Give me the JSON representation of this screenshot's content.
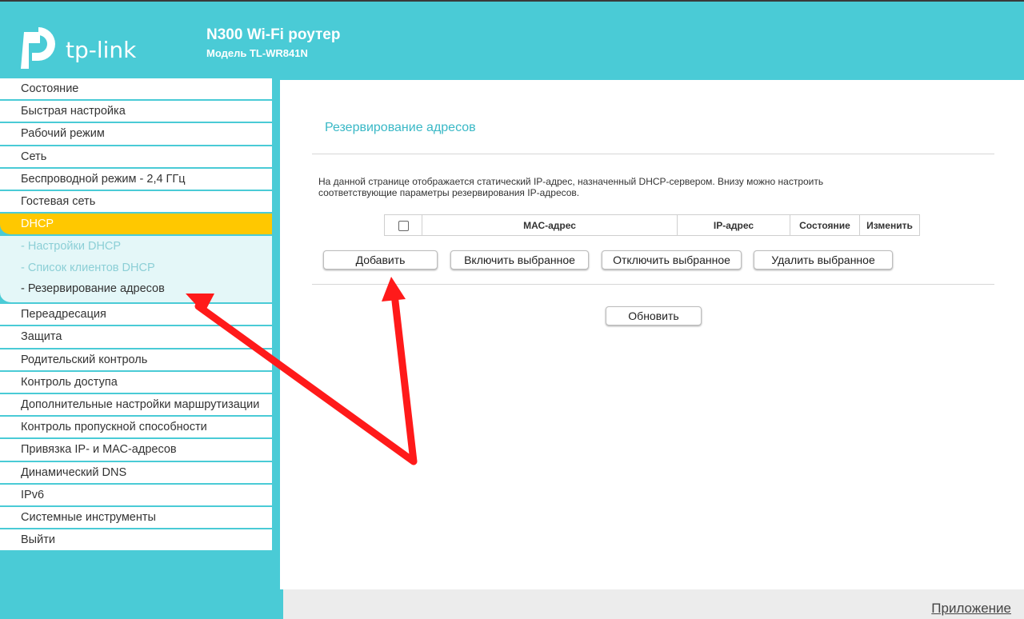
{
  "header": {
    "product_name": "N300 Wi-Fi роутер",
    "model_name": "Модель TL-WR841N",
    "logo_text": "tp-link"
  },
  "sidebar": {
    "items_top": [
      {
        "label": "Состояние"
      },
      {
        "label": "Быстрая настройка"
      },
      {
        "label": "Рабочий режим"
      },
      {
        "label": "Сеть"
      },
      {
        "label": "Беспроводной режим - 2,4 ГГц"
      },
      {
        "label": "Гостевая сеть"
      }
    ],
    "active_item": {
      "label": "DHCP"
    },
    "sub_items": [
      {
        "label": "- Настройки DHCP"
      },
      {
        "label": "- Список клиентов DHCP"
      },
      {
        "label": "- Резервирование адресов"
      }
    ],
    "items_bottom": [
      {
        "label": "Переадресация"
      },
      {
        "label": "Защита"
      },
      {
        "label": "Родительский контроль"
      },
      {
        "label": "Контроль доступа"
      },
      {
        "label": "Дополнительные настройки маршрутизации"
      },
      {
        "label": "Контроль пропускной способности"
      },
      {
        "label": "Привязка IP- и МАС-адресов"
      },
      {
        "label": "Динамический DNS"
      },
      {
        "label": "IPv6"
      },
      {
        "label": "Системные инструменты"
      },
      {
        "label": "Выйти"
      }
    ]
  },
  "main": {
    "title": "Резервирование адресов",
    "description_line1": "На данной странице отображается статический IP-адрес, назначенный DHCP-сервером. Внизу можно настроить",
    "description_line2": "соответствующие параметры резервирования IP-адресов.",
    "table": {
      "columns": [
        "МАС-адрес",
        "IP-адрес",
        "Состояние",
        "Изменить"
      ]
    },
    "buttons": {
      "add": "Добавить",
      "enable_selected": "Включить выбранное",
      "disable_selected": "Отключить выбранное",
      "delete_selected": "Удалить выбранное",
      "refresh": "Обновить"
    }
  },
  "footer": {
    "app_link": "Приложение"
  },
  "colors": {
    "brand": "#4acbd6",
    "active": "#ffc800",
    "title": "#39b8c6",
    "arrow": "#ff1a1a"
  }
}
